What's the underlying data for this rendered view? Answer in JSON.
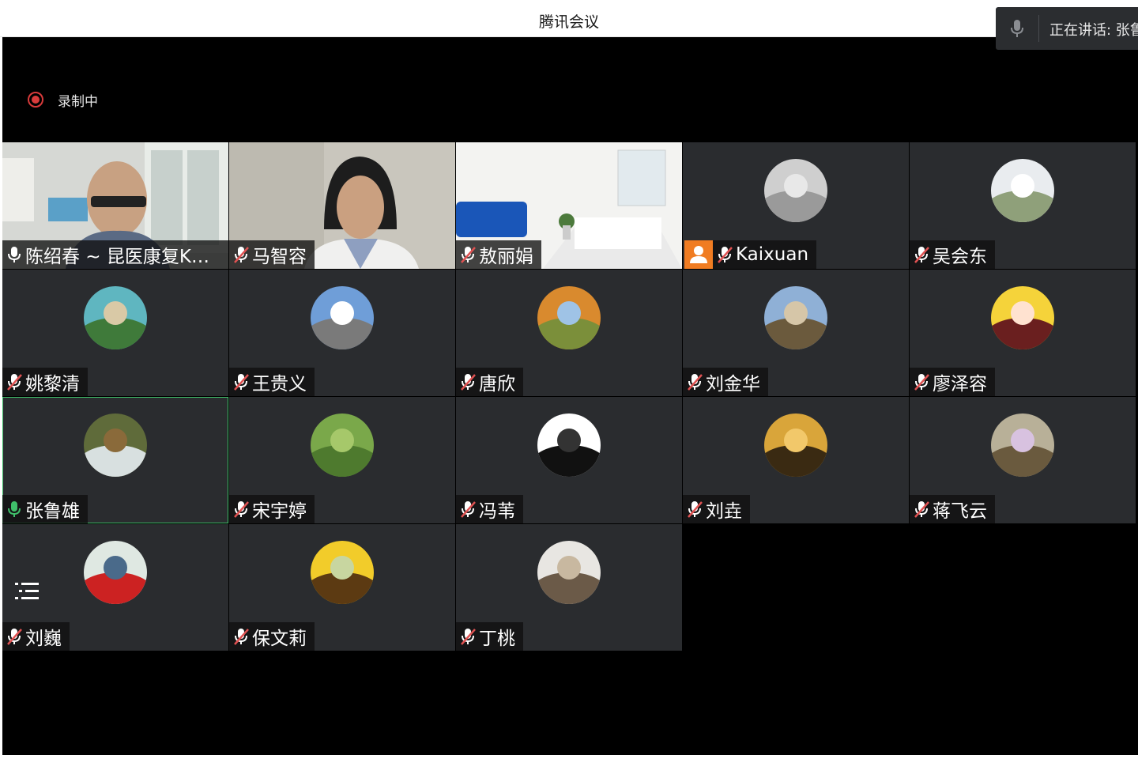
{
  "window": {
    "title": "腾讯会议"
  },
  "speaking_indicator": {
    "text": "正在讲话: 张鲁雄",
    "icon": "mic-icon"
  },
  "recording": {
    "label": "录制中",
    "color": "#d93b3b"
  },
  "participants": [
    {
      "name": "陈绍春 ~ 昆医康复KMMU",
      "mic": "on",
      "media": "video-office"
    },
    {
      "name": "马智容",
      "mic": "muted",
      "media": "video-woman"
    },
    {
      "name": "敖丽娟",
      "mic": "muted",
      "media": "virtual-background-room"
    },
    {
      "name": "Kaixuan",
      "mic": "muted",
      "media": "avatar-sketch",
      "host_badge": true
    },
    {
      "name": "吴会东",
      "mic": "muted",
      "media": "avatar-white-flower"
    },
    {
      "name": "姚黎清",
      "mic": "muted",
      "media": "avatar-lake-tree"
    },
    {
      "name": "王贵义",
      "mic": "muted",
      "media": "avatar-street-sky"
    },
    {
      "name": "唐欣",
      "mic": "muted",
      "media": "avatar-autumn-tree"
    },
    {
      "name": "刘金华",
      "mic": "muted",
      "media": "avatar-palace"
    },
    {
      "name": "廖泽容",
      "mic": "muted",
      "media": "avatar-cartoon-girl"
    },
    {
      "name": "张鲁雄",
      "mic": "speaking",
      "media": "avatar-waterfall",
      "active": true
    },
    {
      "name": "宋宇婷",
      "mic": "muted",
      "media": "avatar-green-plant"
    },
    {
      "name": "冯苇",
      "mic": "muted",
      "media": "avatar-black-sheep"
    },
    {
      "name": "刘垚",
      "mic": "muted",
      "media": "avatar-moon-tree"
    },
    {
      "name": "蒋飞云",
      "mic": "muted",
      "media": "avatar-flower-wood"
    },
    {
      "name": "刘巍",
      "mic": "muted",
      "media": "avatar-red-cape"
    },
    {
      "name": "保文莉",
      "mic": "muted",
      "media": "avatar-sunflower"
    },
    {
      "name": "丁桃",
      "mic": "muted",
      "media": "avatar-sloth"
    }
  ],
  "controls": {
    "list_icon": "list-icon"
  },
  "colors": {
    "stage": "#000000",
    "tile": "#2a2c2f",
    "speaking_mic": "#3fbf6a",
    "muted_mic": "#e05252",
    "host_badge": "#f07c22"
  }
}
